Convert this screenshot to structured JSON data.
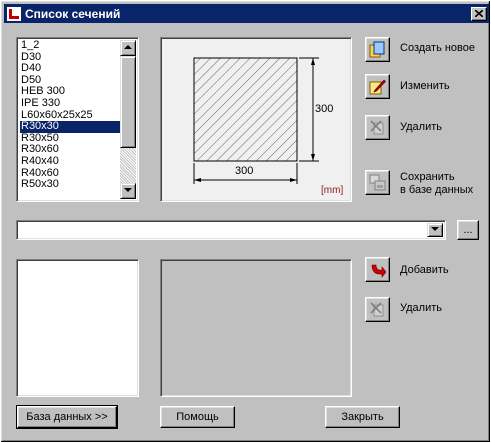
{
  "window": {
    "title": "Список сечений"
  },
  "sections_list": {
    "items": [
      "1_2",
      "D30",
      "D40",
      "D50",
      "HEB 300",
      "IPE 330",
      "L60x60x25x25",
      "R30x30",
      "R30x50",
      "R30x60",
      "R40x40",
      "R40x60",
      "R50x30"
    ],
    "selected": "R30x30"
  },
  "preview": {
    "width_label": "300",
    "height_label": "300",
    "unit": "[mm]"
  },
  "actions": {
    "create_new": "Создать новое",
    "edit": "Изменить",
    "delete": "Удалить",
    "save_db_line1": "Сохранить",
    "save_db_line2": "в базе данных"
  },
  "database": {
    "combo_value": "",
    "browse_label": "...",
    "add": "Добавить",
    "delete": "Удалить"
  },
  "footer": {
    "database_button": "База данных >>",
    "help_button": "Помощь",
    "close_button": "Закрыть"
  }
}
